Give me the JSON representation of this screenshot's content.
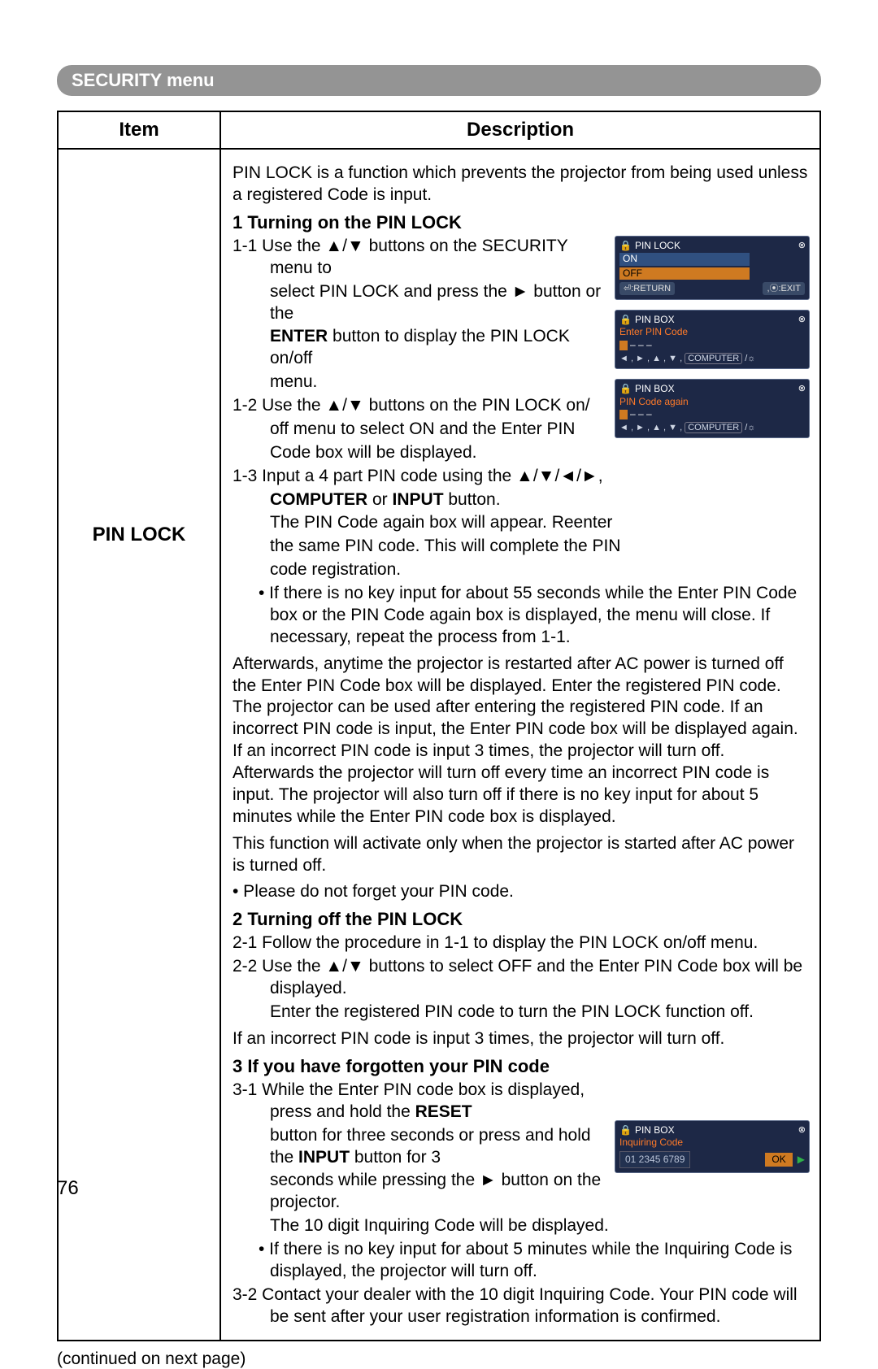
{
  "menu": {
    "title": "SECURITY menu"
  },
  "table": {
    "head": {
      "item": "Item",
      "desc": "Description"
    },
    "row": {
      "item": "PIN LOCK",
      "intro": "PIN LOCK is a function which prevents the projector from being used unless a registered Code is input.",
      "sec1": {
        "heading": "1 Turning on the PIN LOCK",
        "p11a": "1-1 Use the ▲/▼ buttons on the SECURITY menu to",
        "p11b": "select PIN LOCK and press the ► button or the",
        "p11c_prefix": "",
        "enter": "ENTER",
        "p11c_suffix": " button to display the PIN LOCK on/off",
        "p11d": "menu.",
        "p12a": "1-2 Use the ▲/▼ buttons on the PIN LOCK on/",
        "p12b": "off menu to select ON and the Enter PIN",
        "p12c": "Code box will be displayed.",
        "p13a": "1-3 Input a 4 part PIN code using the ▲/▼/◄/►,",
        "computer": "COMPUTER",
        "or": " or ",
        "input": "INPUT",
        "p13b_suffix": " button.",
        "p13c": "The PIN Code again box will appear. Reenter",
        "p13d": "the same PIN code. This will complete the PIN",
        "p13e": "code registration.",
        "bullet1": "• If there is no key input for about 55 seconds while the Enter PIN Code box or the PIN Code again box is displayed, the menu will close. If necessary, repeat the process from 1-1.",
        "after": "Afterwards, anytime the projector is restarted after AC power  is turned off the Enter PIN Code box will be displayed. Enter the registered PIN code. The projector can be used after entering the registered PIN code. If an incorrect PIN code is input, the Enter PIN code box will be displayed again. If an incorrect PIN code is input 3 times, the projector will turn off. Afterwards the projector will turn off every time an incorrect PIN code is input. The projector will also turn off if there is no key input for about 5 minutes while the Enter PIN code box is displayed.",
        "activate": "This function will activate only when the projector is started after AC power is turned off.",
        "forget": "• Please do not forget your PIN code."
      },
      "sec2": {
        "heading": "2 Turning off the PIN LOCK",
        "p21": "2-1 Follow the procedure in 1-1 to display the PIN LOCK on/off menu.",
        "p22": "2-2 Use the ▲/▼ buttons to select OFF and the Enter PIN Code box will be displayed.",
        "p22b": "Enter the registered PIN code to turn the PIN LOCK function off.",
        "p2c": "If an incorrect PIN code is input 3 times, the projector will turn off."
      },
      "sec3": {
        "heading": "3 If you have forgotten your PIN code",
        "p31a": "3-1 While the Enter PIN code box is displayed, press and hold the ",
        "reset": "RESET",
        "p31b": "button for three seconds or press and hold the ",
        "input": "INPUT",
        "p31c": " button for 3",
        "p31d": "seconds while pressing the ► button on the projector.",
        "p31e": "The 10 digit Inquiring Code will be displayed.",
        "bullet": "• If there is no key input for about 5 minutes while the Inquiring Code is displayed, the projector will turn off.",
        "p32": "3-2 Contact your dealer with the 10 digit Inquiring Code. Your PIN code will be sent after your user registration information is confirmed."
      }
    }
  },
  "osd": {
    "box1": {
      "title": "PIN LOCK",
      "on": "ON",
      "off": "OFF",
      "return": "⏎:RETURN",
      "exit": ",⦿:EXIT"
    },
    "box2": {
      "title": "PIN BOX",
      "enter": "Enter PIN Code",
      "hint": "◄ , ► , ▲ , ▼ , COMPUTER /☼"
    },
    "box3": {
      "title": "PIN BOX",
      "again": "PIN Code again",
      "hint": "◄ , ► , ▲ , ▼ , COMPUTER /☼"
    },
    "box4": {
      "title": "PIN BOX",
      "inq": "Inquiring Code",
      "code": "01 2345 6789",
      "ok": "OK"
    }
  },
  "continued": "(continued on next page)",
  "page_num": "76"
}
